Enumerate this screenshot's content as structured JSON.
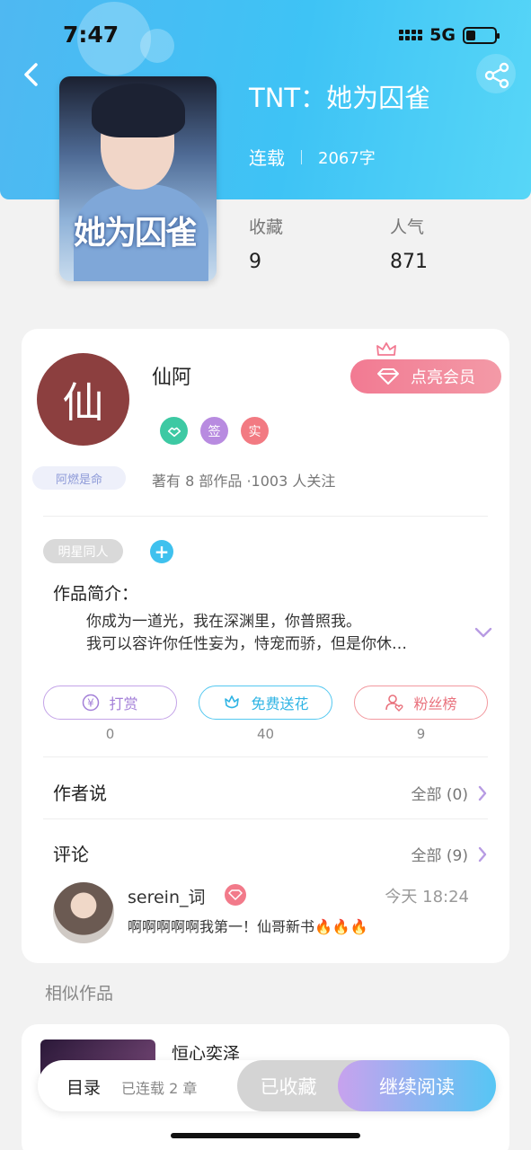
{
  "status_bar": {
    "time": "7:47",
    "network": "5G"
  },
  "book": {
    "title": "TNT：她为囚雀",
    "cover_title": "她为囚雀",
    "status": "连载",
    "word_count": "2067字",
    "stats": [
      {
        "label": "收藏",
        "value": "9"
      },
      {
        "label": "人气",
        "value": "871"
      }
    ]
  },
  "author": {
    "avatar_char": "仙",
    "name": "仙阿",
    "badges": [
      "签",
      "实"
    ],
    "fan_tag": "阿燃是命",
    "works_info": "著有 8 部作品 ·1003 人关注",
    "vip_button": "点亮会员"
  },
  "tags": [
    "明星同人"
  ],
  "intro": {
    "label": "作品简介：",
    "lines": [
      "你成为一道光，我在深渊里，你普照我。",
      "我可以容许你任性妄为，恃宠而骄，但是你休…"
    ]
  },
  "actions": [
    {
      "label": "打赏",
      "count": "0"
    },
    {
      "label": "免费送花",
      "count": "40"
    },
    {
      "label": "粉丝榜",
      "count": "9"
    }
  ],
  "author_says": {
    "title": "作者说",
    "more": "全部 (0)"
  },
  "comments": {
    "title": "评论",
    "more": "全部 (9)",
    "items": [
      {
        "user": "serein_词",
        "time": "今天 18:24",
        "text": "啊啊啊啊啊我第一！仙哥新书🔥🔥🔥"
      }
    ]
  },
  "similar": {
    "label": "相似作品",
    "first_title": "恒心奕泽"
  },
  "bottom_bar": {
    "toc": "目录",
    "toc_sub": "已连载 2 章",
    "collected": "已收藏",
    "continue": "继续阅读"
  },
  "colors": {
    "header": "#3ec3f5",
    "vip": "#f27a92",
    "accent_blue": "#3fc1ee"
  }
}
